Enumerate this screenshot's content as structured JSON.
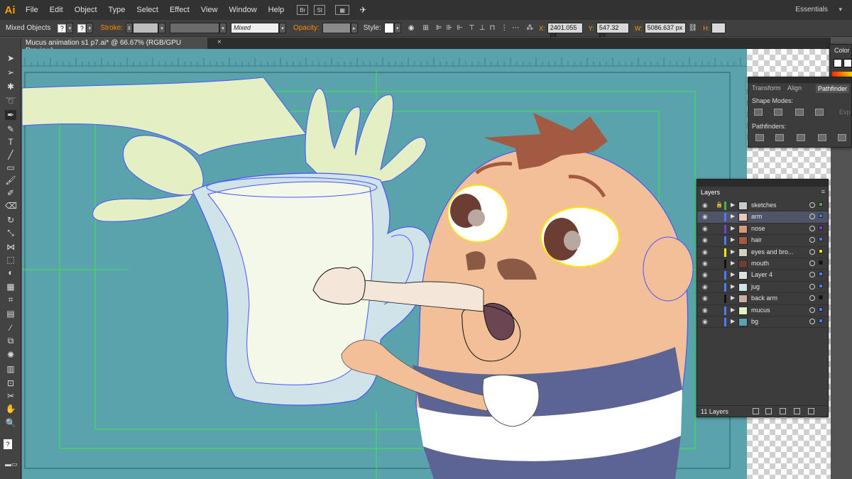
{
  "app": {
    "logo": "Ai"
  },
  "menu": [
    "File",
    "Edit",
    "Object",
    "Type",
    "Select",
    "Effect",
    "View",
    "Window",
    "Help"
  ],
  "menubar_buttons": [
    "Br",
    "St"
  ],
  "workspace": "Essentials",
  "controlbar": {
    "selection": "Mixed Objects",
    "stroke_label": "Stroke:",
    "opacity_label": "Opacity:",
    "mixed": "Mixed",
    "style_label": "Style:",
    "x_label": "X:",
    "x_value": "2401.055 px",
    "y_label": "Y:",
    "y_value": "547.32 px",
    "w_label": "W:",
    "w_value": "5086.637 px",
    "h_label": "H:"
  },
  "document": {
    "tab_title": "Mucus animation s1 p7.ai* @ 66.67% (RGB/GPU Preview)",
    "close": "×"
  },
  "color_panel": {
    "tab": "Color"
  },
  "transform_panel": {
    "tabs": [
      "Transform",
      "Align",
      "Pathfinder"
    ],
    "shape_modes": "Shape Modes:",
    "pathfinders": "Pathfinders:",
    "expand": "Exp"
  },
  "layers_panel": {
    "title": "Layers",
    "footer_count": "11 Layers",
    "layers": [
      {
        "name": "sketches",
        "color": "#4cae4c",
        "locked": true,
        "selected": false
      },
      {
        "name": "arm",
        "color": "#4c7cff",
        "locked": false,
        "selected": true
      },
      {
        "name": "nose",
        "color": "#7a3ddb",
        "locked": false,
        "selected": false
      },
      {
        "name": "hair",
        "color": "#4c7cff",
        "locked": false,
        "selected": false
      },
      {
        "name": "eyes and bro...",
        "color": "#ffe600",
        "locked": false,
        "selected": false
      },
      {
        "name": "mouth",
        "color": "#111111",
        "locked": false,
        "selected": false
      },
      {
        "name": "Layer 4",
        "color": "#4c7cff",
        "locked": false,
        "selected": false
      },
      {
        "name": "jug",
        "color": "#4c7cff",
        "locked": false,
        "selected": false
      },
      {
        "name": "back arm",
        "color": "#111111",
        "locked": false,
        "selected": false
      },
      {
        "name": "mucus",
        "color": "#4c7cff",
        "locked": false,
        "selected": false
      },
      {
        "name": "bg",
        "color": "#4c7cff",
        "locked": false,
        "selected": false
      }
    ]
  },
  "colors": {
    "canvas_bg": "#5aa3ad",
    "mucus": "#e4efc4",
    "jug": "#cfe3e8",
    "skin": "#f2bf98",
    "hair": "#a35a43",
    "stripe": "#5b6494",
    "selection_blue": "#4a55ff",
    "guide_green": "#37e84a"
  }
}
